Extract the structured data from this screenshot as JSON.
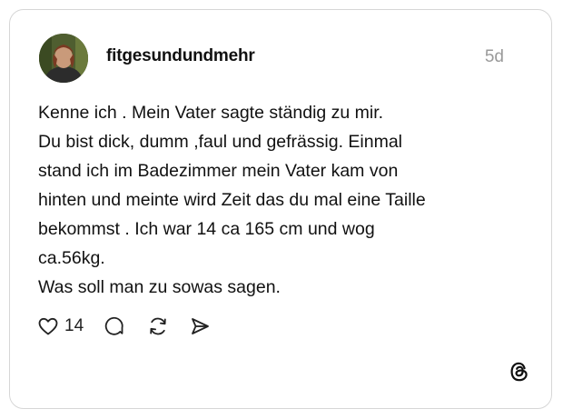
{
  "post": {
    "username": "fitgesundundmehr",
    "timestamp": "5d",
    "text_lines": [
      "Kenne ich . Mein Vater sagte ständig zu mir.",
      "Du bist dick, dumm ,faul und gefrässig. Einmal",
      "stand ich im Badezimmer mein Vater kam von",
      "hinten und meinte wird Zeit das du mal eine Taille",
      "bekommst . Ich war 14 ca 165 cm und wog",
      "ca.56kg.",
      "Was soll man zu sowas sagen."
    ],
    "like_count": "14"
  },
  "icons": {
    "like": "heart-icon",
    "comment": "comment-bubble-icon",
    "repost": "repost-icon",
    "share": "send-icon",
    "brand": "threads-logo-icon"
  },
  "colors": {
    "text": "#111111",
    "muted": "#9a9a9a",
    "border": "#d6d6d6"
  }
}
